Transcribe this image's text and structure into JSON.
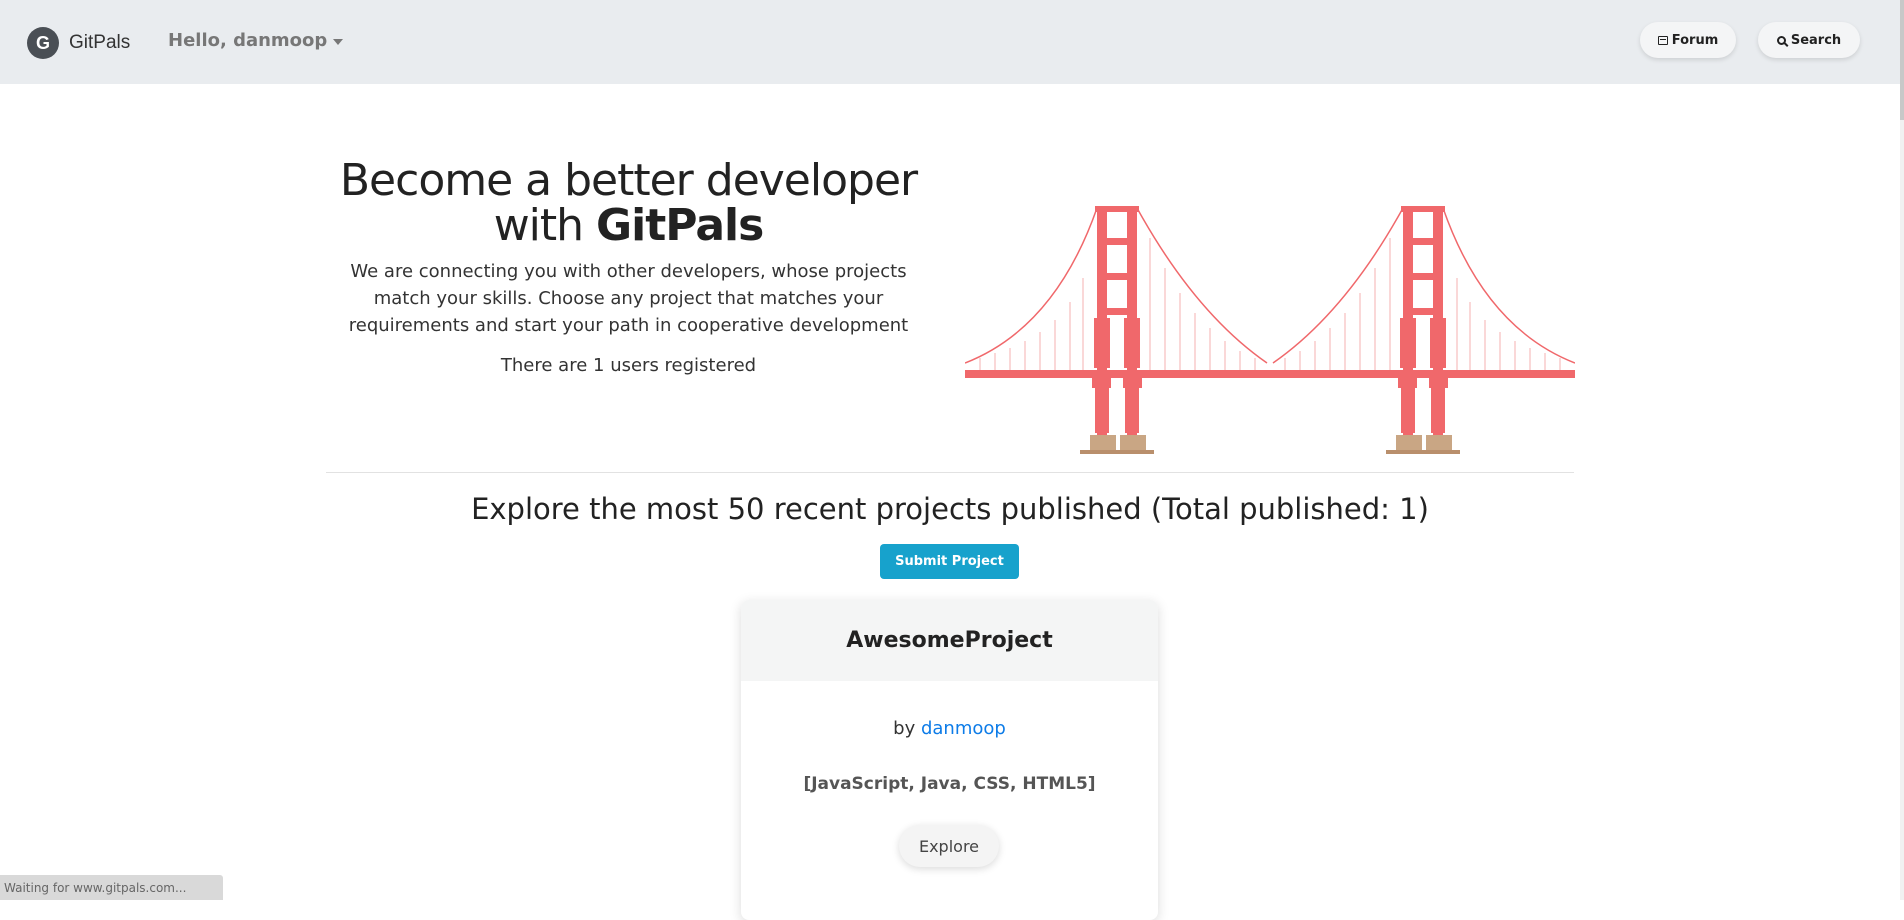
{
  "navbar": {
    "brand_logo_letter": "G",
    "brand_name": "GitPals",
    "greeting": "Hello, danmoop",
    "forum_label": "Forum",
    "search_label": "Search"
  },
  "hero": {
    "title_line1": "Become a better developer",
    "title_with": "with",
    "title_brand": "GitPals",
    "description": "We are connecting you with other developers, whose projects match your skills. Choose any project that matches your requirements and start your path in cooperative development",
    "users_registered": "There are 1 users registered"
  },
  "projects": {
    "heading": "Explore the most 50 recent projects published (Total published: 1)",
    "submit_label": "Submit Project",
    "items": [
      {
        "name": "AwesomeProject",
        "by_label": "by",
        "author": "danmoop",
        "tags": "[JavaScript, Java, CSS, HTML5]",
        "explore_label": "Explore"
      }
    ]
  },
  "status_bar": {
    "text": "Waiting for www.gitpals.com..."
  },
  "colors": {
    "navbar_bg": "#e9ecef",
    "bridge_red": "#f0686b",
    "bridge_base": "#c9a684",
    "submit_bg": "#17a2cc",
    "link_blue": "#0d7ce8"
  }
}
